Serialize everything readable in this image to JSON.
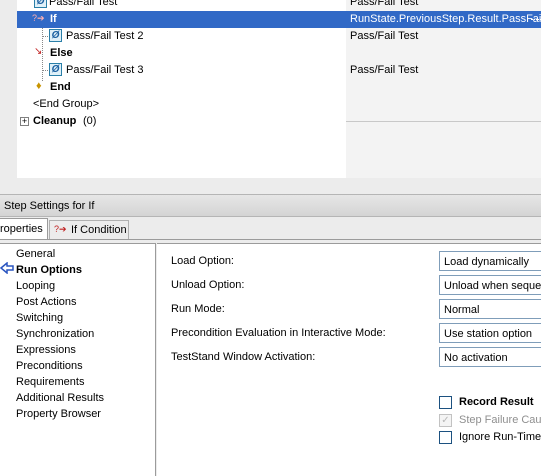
{
  "sequence": {
    "rows": [
      {
        "step": "Pass/Fail Test",
        "description": "Pass/Fail Test",
        "icon": "pass-fail-icon"
      },
      {
        "step": "If",
        "description": "RunState.PreviousStep.Result.PassFail",
        "icon": "if-flow-icon",
        "selected": true
      },
      {
        "step": "Pass/Fail Test 2",
        "description": "Pass/Fail Test",
        "icon": "pass-fail-icon"
      },
      {
        "step": "Else",
        "description": "",
        "icon": "else-flow-icon"
      },
      {
        "step": "Pass/Fail Test 3",
        "description": "Pass/Fail Test",
        "icon": "pass-fail-icon"
      },
      {
        "step": "End",
        "description": "",
        "icon": "end-flow-icon"
      },
      {
        "step": "<End Group>",
        "description": "",
        "icon": ""
      },
      {
        "step": "Cleanup",
        "count": "(0)",
        "description": "",
        "icon": "expand-icon"
      }
    ]
  },
  "settings": {
    "title": "Step Settings for If",
    "tabs": [
      {
        "label": "roperties",
        "active": true
      },
      {
        "label": "If Condition",
        "icon": "if-flow-icon",
        "active": false
      }
    ],
    "categories": [
      "General",
      "Run Options",
      "Looping",
      "Post Actions",
      "Switching",
      "Synchronization",
      "Expressions",
      "Preconditions",
      "Requirements",
      "Additional Results",
      "Property Browser"
    ],
    "active_category": "Run Options",
    "fields": [
      {
        "label": "Load Option:",
        "value": "Load dynamically"
      },
      {
        "label": "Unload Option:",
        "value": "Unload when sequer"
      },
      {
        "label": "Run Mode:",
        "value": "Normal"
      },
      {
        "label": "Precondition Evaluation in Interactive Mode:",
        "value": "Use station option"
      },
      {
        "label": "TestStand Window Activation:",
        "value": "No activation"
      }
    ],
    "checks": [
      {
        "label": "Record Result",
        "checked": false,
        "enabled": true,
        "bold": true
      },
      {
        "label": "Step Failure Caus",
        "checked": true,
        "enabled": false
      },
      {
        "label": "Ignore Run-Time",
        "checked": false,
        "enabled": true
      }
    ]
  },
  "colors": {
    "selection": "#3169c6",
    "panel": "#ececec"
  }
}
